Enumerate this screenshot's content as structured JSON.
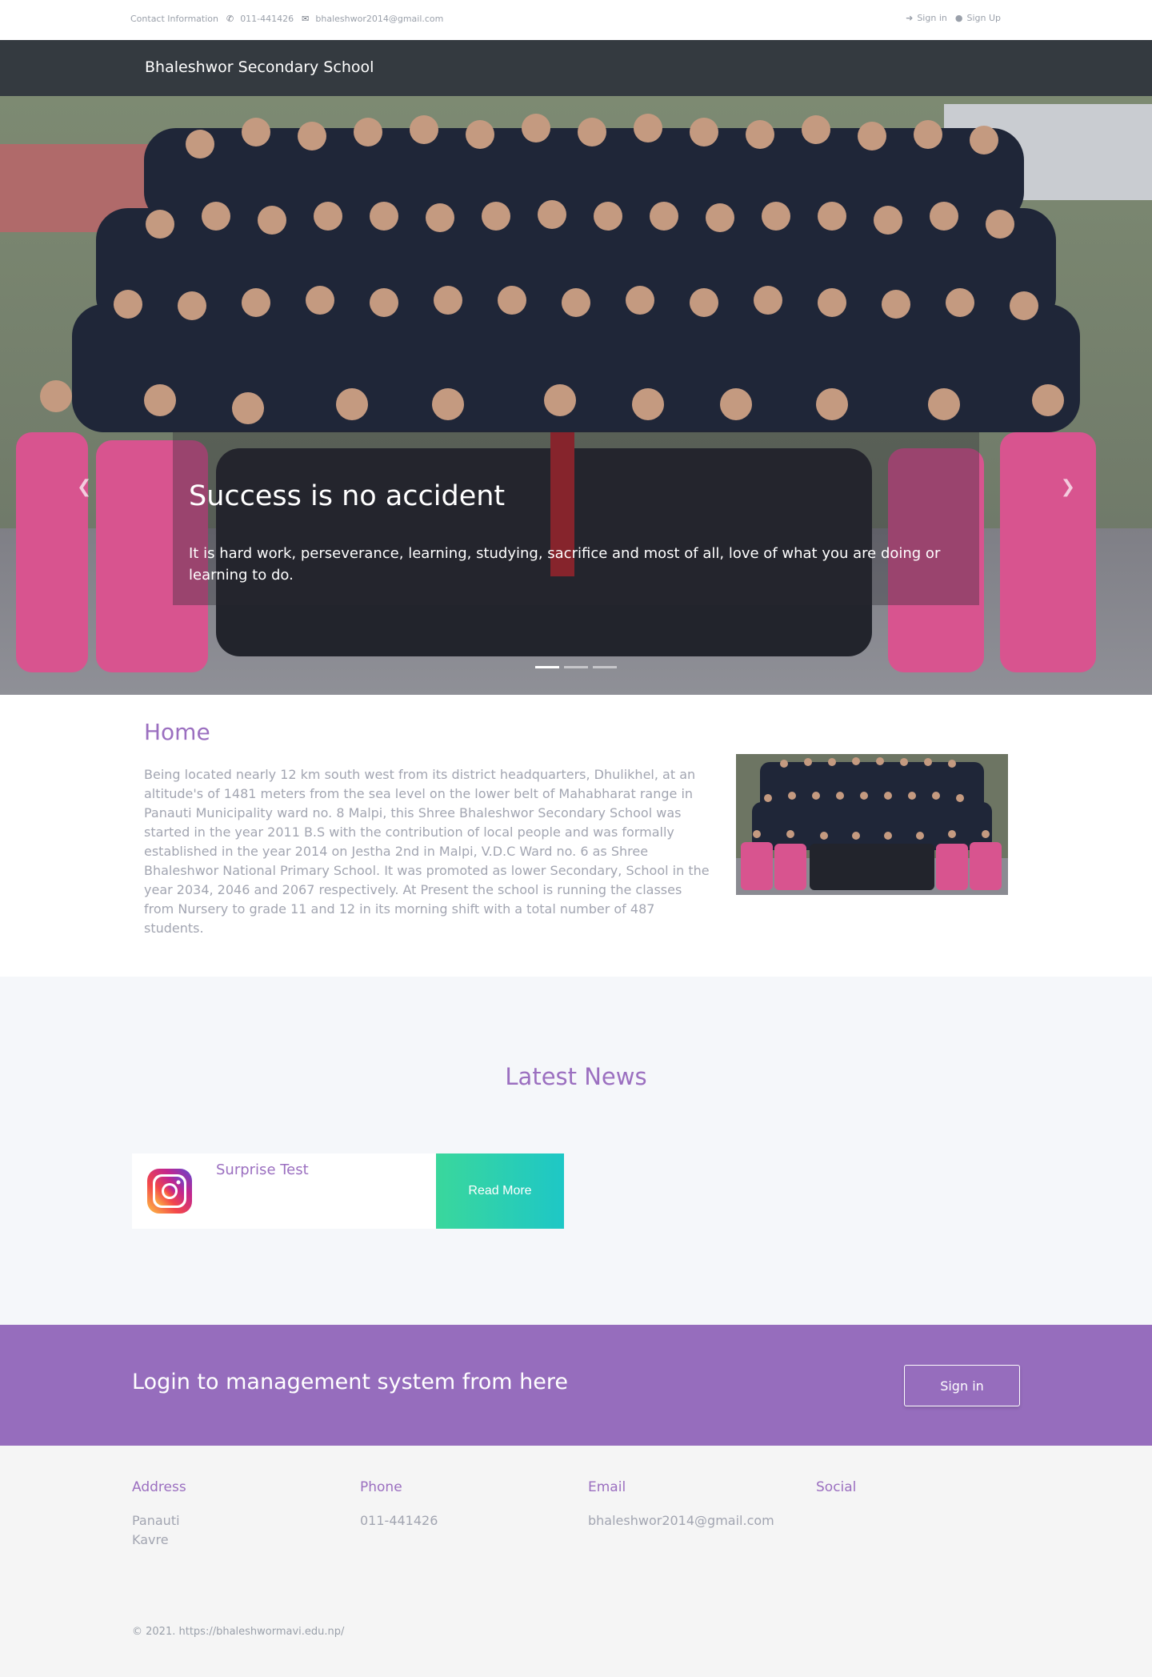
{
  "topbar": {
    "contact_label": "Contact Information",
    "phone": "011-441426",
    "email": "bhaleshwor2014@gmail.com",
    "sign_in": "Sign in",
    "sign_up": "Sign Up",
    "phone_icon": "phone-icon",
    "email_icon": "envelope-icon",
    "sign_in_icon": "sign-in-icon",
    "sign_up_icon": "user-icon"
  },
  "navbar": {
    "brand": "Bhaleshwor Secondary School"
  },
  "hero": {
    "title": "Success is no accident",
    "text": "It is hard work, perseverance, learning, studying, sacrifice and most of all, love of what you are doing or learning to do.",
    "prev_icon": "chevron-left-icon",
    "next_icon": "chevron-right-icon",
    "slides": 3,
    "active_slide": 1
  },
  "home": {
    "heading": "Home",
    "body": "Being located nearly 12 km south west from its district headquarters, Dhulikhel, at an altitude's of 1481 meters from the sea level on the lower belt of Mahabharat range in Panauti Municipality ward no. 8 Malpi, this Shree Bhaleshwor Secondary School was started in the year 2011 B.S with the contribution of local people and was formally established in the year 2014 on Jestha 2nd in Malpi, V.D.C Ward no. 6 as Shree Bhaleshwor National Primary School. It was promoted as lower Secondary, School in the year 2034, 2046 and 2067 respectively. At Present the school is running the classes from Nursery to grade 11 and 12 in its morning shift with a total number of 487 students."
  },
  "news": {
    "heading": "Latest News",
    "items": [
      {
        "title": "Surprise Test",
        "button": "Read More",
        "icon": "instagram-icon"
      }
    ]
  },
  "login": {
    "text": "Login to management system from here",
    "button": "Sign in"
  },
  "footer": {
    "address": {
      "heading": "Address",
      "lines": [
        "Panauti",
        "Kavre"
      ]
    },
    "phone": {
      "heading": "Phone",
      "lines": [
        "011-441426"
      ]
    },
    "email": {
      "heading": "Email",
      "lines": [
        "bhaleshwor2014@gmail.com"
      ]
    },
    "social": {
      "heading": "Social"
    },
    "copyright": "© 2021. https://bhaleshwormavi.edu.np/"
  },
  "colors": {
    "accent": "#9b6fc0",
    "navbar": "#343a40",
    "banner": "#966dbd",
    "read_more_start": "#3ad79c",
    "read_more_end": "#1ec7c6"
  }
}
